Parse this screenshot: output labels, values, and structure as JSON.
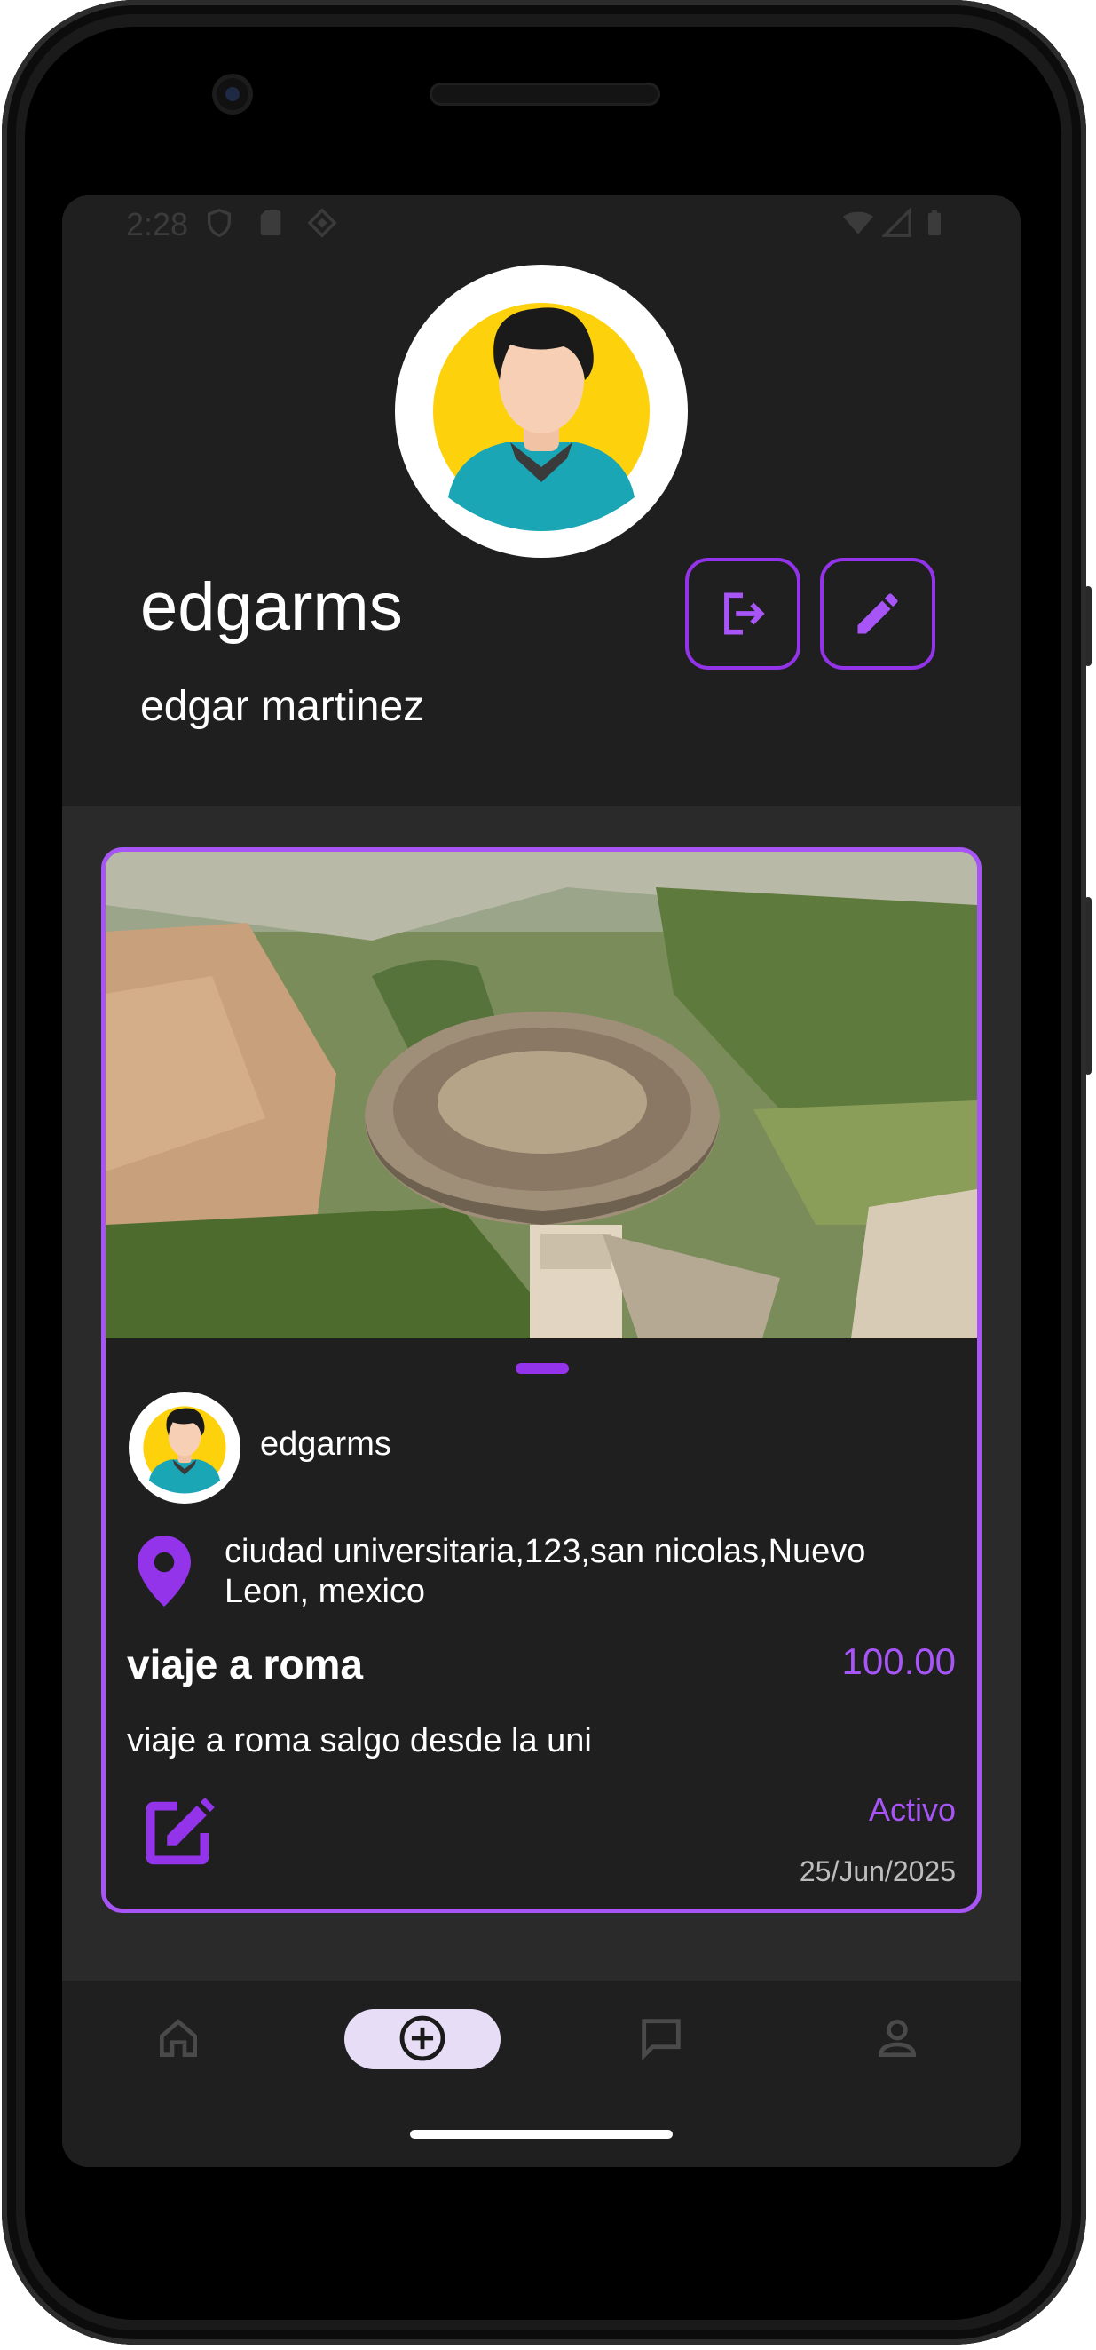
{
  "status_bar": {
    "time": "2:28"
  },
  "profile": {
    "username": "edgarms",
    "full_name": "edgar martinez",
    "logout_icon": "logout-icon",
    "edit_icon": "pencil-icon"
  },
  "trip_card": {
    "image_description": "aerial-colosseum-photo",
    "user": "edgarms",
    "address": "ciudad universitaria,123,san nicolas,Nuevo Leon, mexico",
    "title": "viaje a roma",
    "price": "100.00",
    "description": "viaje a roma salgo desde la uni",
    "status": "Activo",
    "date": "25/Jun/2025"
  },
  "bottom_nav": {
    "items": [
      {
        "icon": "home-icon",
        "active": false
      },
      {
        "icon": "add-circle-icon",
        "active": true
      },
      {
        "icon": "chat-icon",
        "active": false
      },
      {
        "icon": "person-icon",
        "active": false
      }
    ]
  },
  "colors": {
    "accent": "#a855f7",
    "accent_dark": "#9333ea",
    "background": "#222222",
    "nav_pill": "#e8ddf7"
  }
}
